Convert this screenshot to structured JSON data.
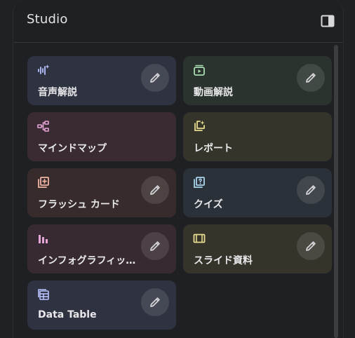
{
  "panel": {
    "title": "Studio",
    "toggle_icon": "side-panel-icon"
  },
  "colors": {
    "audio": "#2f3240",
    "video": "#2a332d",
    "mindmap": "#3a2a33",
    "report": "#34342a",
    "flashcards": "#372c2b",
    "quiz": "#2b3139",
    "infographic": "#382a33",
    "slides": "#35332a",
    "datatable": "#2f3240"
  },
  "tools": [
    {
      "label": "音声解説",
      "icon": "audio-waveform-icon",
      "has_edit": true
    },
    {
      "label": "動画解説",
      "icon": "video-play-icon",
      "has_edit": true
    },
    {
      "label": "マインドマップ",
      "icon": "mind-map-icon",
      "has_edit": false
    },
    {
      "label": "レポート",
      "icon": "report-sparkle-icon",
      "has_edit": false
    },
    {
      "label": "フラッシュ カード",
      "icon": "flashcards-icon",
      "has_edit": true
    },
    {
      "label": "クイズ",
      "icon": "quiz-icon",
      "has_edit": true
    },
    {
      "label": "インフォグラフィッ…",
      "icon": "bar-chart-icon",
      "has_edit": true
    },
    {
      "label": "スライド資料",
      "icon": "slides-icon",
      "has_edit": true
    },
    {
      "label": "Data Table",
      "icon": "table-icon",
      "has_edit": true
    }
  ]
}
